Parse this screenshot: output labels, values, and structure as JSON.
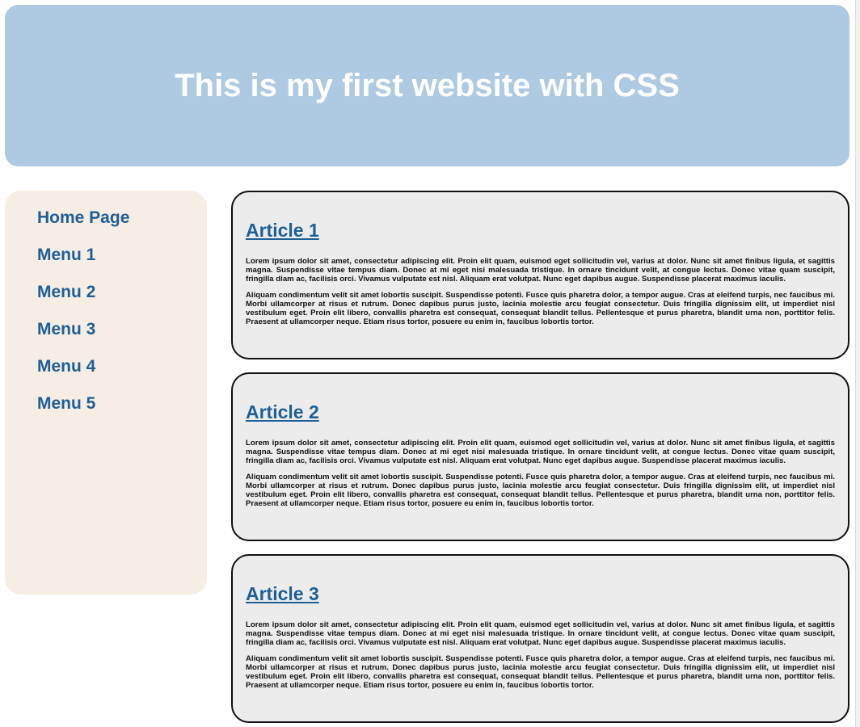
{
  "header": {
    "title": "This is my first website with CSS"
  },
  "sidebar": {
    "items": [
      {
        "label": "Home Page"
      },
      {
        "label": "Menu 1"
      },
      {
        "label": "Menu 2"
      },
      {
        "label": "Menu 3"
      },
      {
        "label": "Menu 4"
      },
      {
        "label": "Menu 5"
      }
    ]
  },
  "articles": [
    {
      "title": "Article 1",
      "paragraphs": [
        "Lorem ipsum dolor sit amet, consectetur adipiscing elit. Proin elit quam, euismod eget sollicitudin vel, varius at dolor. Nunc sit amet finibus ligula, et sagittis magna. Suspendisse vitae tempus diam. Donec at mi eget nisi malesuada tristique. In ornare tincidunt velit, at congue lectus. Donec vitae quam suscipit, fringilla diam ac, facilisis orci. Vivamus vulputate est nisl. Aliquam erat volutpat. Nunc eget dapibus augue. Suspendisse placerat maximus iaculis.",
        "Aliquam condimentum velit sit amet lobortis suscipit. Suspendisse potenti. Fusce quis pharetra dolor, a tempor augue. Cras at eleifend turpis, nec faucibus mi. Morbi ullamcorper at risus et rutrum. Donec dapibus purus justo, lacinia molestie arcu feugiat consectetur. Duis fringilla dignissim elit, ut imperdiet nisl vestibulum eget. Proin elit libero, convallis pharetra est consequat, consequat blandit tellus. Pellentesque et purus pharetra, blandit urna non, porttitor felis. Praesent at ullamcorper neque. Etiam risus tortor, posuere eu enim in, faucibus lobortis tortor."
      ]
    },
    {
      "title": "Article 2",
      "paragraphs": [
        "Lorem ipsum dolor sit amet, consectetur adipiscing elit. Proin elit quam, euismod eget sollicitudin vel, varius at dolor. Nunc sit amet finibus ligula, et sagittis magna. Suspendisse vitae tempus diam. Donec at mi eget nisi malesuada tristique. In ornare tincidunt velit, at congue lectus. Donec vitae quam suscipit, fringilla diam ac, facilisis orci. Vivamus vulputate est nisl. Aliquam erat volutpat. Nunc eget dapibus augue. Suspendisse placerat maximus iaculis.",
        "Aliquam condimentum velit sit amet lobortis suscipit. Suspendisse potenti. Fusce quis pharetra dolor, a tempor augue. Cras at eleifend turpis, nec faucibus mi. Morbi ullamcorper at risus et rutrum. Donec dapibus purus justo, lacinia molestie arcu feugiat consectetur. Duis fringilla dignissim elit, ut imperdiet nisl vestibulum eget. Proin elit libero, convallis pharetra est consequat, consequat blandit tellus. Pellentesque et purus pharetra, blandit urna non, porttitor felis. Praesent at ullamcorper neque. Etiam risus tortor, posuere eu enim in, faucibus lobortis tortor."
      ]
    },
    {
      "title": "Article 3",
      "paragraphs": [
        "Lorem ipsum dolor sit amet, consectetur adipiscing elit. Proin elit quam, euismod eget sollicitudin vel, varius at dolor. Nunc sit amet finibus ligula, et sagittis magna. Suspendisse vitae tempus diam. Donec at mi eget nisi malesuada tristique. In ornare tincidunt velit, at congue lectus. Donec vitae quam suscipit, fringilla diam ac, facilisis orci. Vivamus vulputate est nisl. Aliquam erat volutpat. Nunc eget dapibus augue. Suspendisse placerat maximus iaculis.",
        "Aliquam condimentum velit sit amet lobortis suscipit. Suspendisse potenti. Fusce quis pharetra dolor, a tempor augue. Cras at eleifend turpis, nec faucibus mi. Morbi ullamcorper at risus et rutrum. Donec dapibus purus justo, lacinia molestie arcu feugiat consectetur. Duis fringilla dignissim elit, ut imperdiet nisl vestibulum eget. Proin elit libero, convallis pharetra est consequat, consequat blandit tellus. Pellentesque et purus pharetra, blandit urna non, porttitor felis. Praesent at ullamcorper neque. Etiam risus tortor, posuere eu enim in, faucibus lobortis tortor."
      ]
    }
  ],
  "colors": {
    "header_bg": "#aec9e2",
    "sidebar_bg": "#f6ede4",
    "article_bg": "#ececec",
    "link": "#1e5f96"
  }
}
